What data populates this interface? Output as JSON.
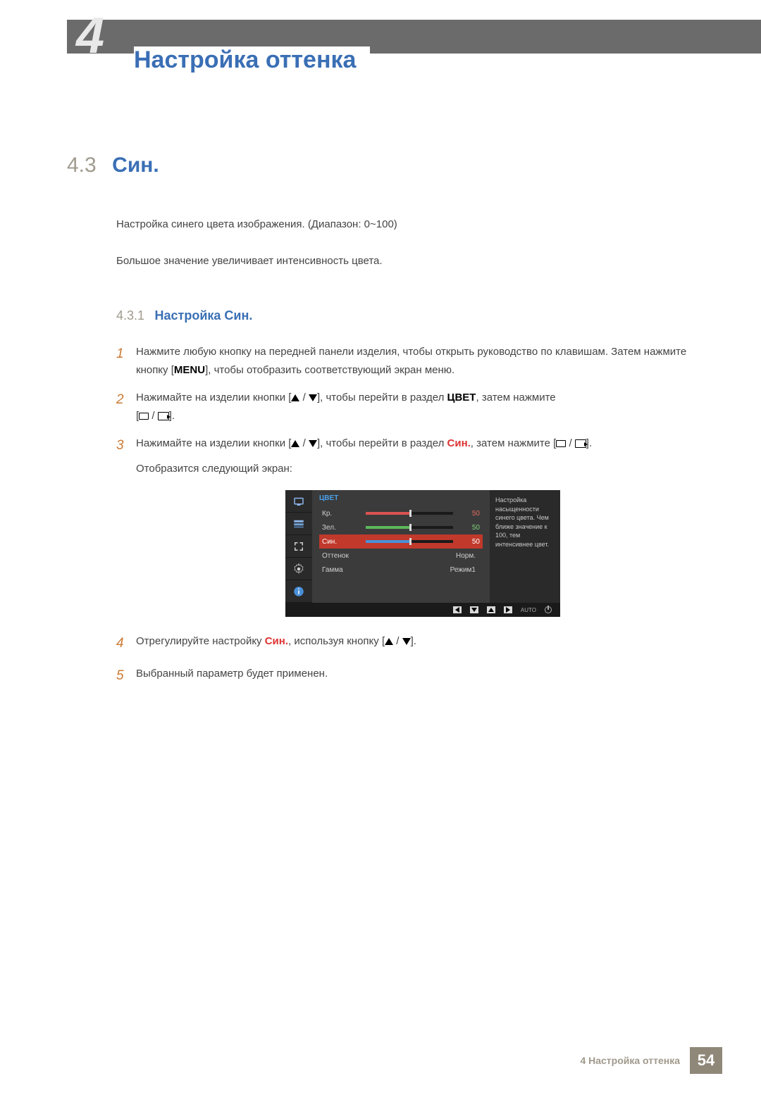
{
  "header": {
    "chapter_number": "4",
    "title": "Настройка оттенка"
  },
  "section": {
    "number": "4.3",
    "title": "Син."
  },
  "intro": {
    "p1": "Настройка синего цвета изображения. (Диапазон: 0~100)",
    "p2": "Большое значение увеличивает интенсивность цвета."
  },
  "subsection": {
    "number": "4.3.1",
    "title": "Настройка Син."
  },
  "steps": {
    "s1": {
      "num": "1",
      "pre": "Нажмите любую кнопку на передней панели изделия, чтобы открыть руководство по клавишам. Затем нажмите кнопку [",
      "menu": "MENU",
      "post": "], чтобы отобразить соответствующий экран меню."
    },
    "s2": {
      "num": "2",
      "pre": "Нажимайте на изделии кнопки [",
      "mid": "], чтобы перейти в раздел ",
      "kw": "ЦВЕТ",
      "post": ", затем нажмите",
      "line2": "[",
      "line2end": "]."
    },
    "s3": {
      "num": "3",
      "pre": "Нажимайте на изделии кнопки [",
      "mid": "], чтобы перейти в раздел ",
      "kw": "Син.",
      "post": ", затем нажмите [",
      "post2": "].",
      "after": "Отобразится следующий экран:"
    },
    "s4": {
      "num": "4",
      "pre": "Отрегулируйте настройку ",
      "kw": "Син.",
      "mid": ", используя кнопку [",
      "post": "]."
    },
    "s5": {
      "num": "5",
      "text": "Выбранный параметр будет применен."
    }
  },
  "osd": {
    "heading": "ЦВЕТ",
    "rows": {
      "r": {
        "label": "Кр.",
        "val": "50"
      },
      "g": {
        "label": "Зел.",
        "val": "50"
      },
      "b": {
        "label": "Син.",
        "val": "50"
      },
      "tint": {
        "label": "Оттенок",
        "val": "Норм."
      },
      "gamma": {
        "label": "Гамма",
        "val": "Режим1"
      }
    },
    "help": "Настройка насыщенности синего цвета. Чем ближе значение к 100, тем интенсивнее цвет.",
    "auto": "AUTO"
  },
  "footer": {
    "text": "4 Настройка оттенка",
    "page": "54"
  }
}
